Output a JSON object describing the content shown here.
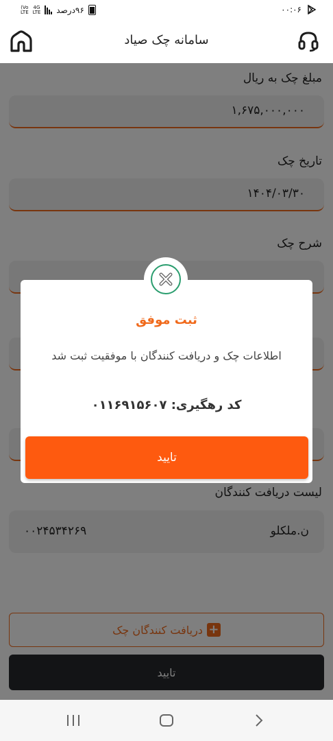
{
  "status_bar": {
    "battery_text": "۹۶درصد",
    "network_label_top": "4G",
    "network_label_bottom": "LTE",
    "volte_top": "Vo)",
    "volte_bottom": "LTE",
    "time": "۰۰:۰۶"
  },
  "appbar": {
    "title": "سامانه چک صیاد",
    "home_icon": "home-icon",
    "support_icon": "headset-icon"
  },
  "form": {
    "amount_label": "مبلغ چک به ریال",
    "amount_value": "۱,۶۷۵,۰۰۰,۰۰۰",
    "date_label": "تاریخ چک",
    "date_value": "۱۴۰۴/۰۳/۳۰",
    "description_label": "شرح چک",
    "receivers_label": "لیست دریافت کنندگان",
    "receiver": {
      "name": "ن.ملکلو",
      "code": "۰۰۲۴۵۳۴۲۶۹"
    },
    "add_receivers_label": "دریافت کنندگان چک",
    "confirm_label": "تایید"
  },
  "dialog": {
    "title": "ثبت موفق",
    "message": "اطلاعات چک و دریافت کنندگان با موفقیت ثبت شد",
    "tracking_label": "کد رهگیری:",
    "tracking_code": "۰۱۱۶۹۱۵۶۰۷",
    "confirm_label": "تایید",
    "accent_color": "#fe5a0f",
    "icon_color": "#2a9d6e"
  },
  "colors": {
    "accent": "#f06a1c",
    "dark_button": "#26282c"
  }
}
